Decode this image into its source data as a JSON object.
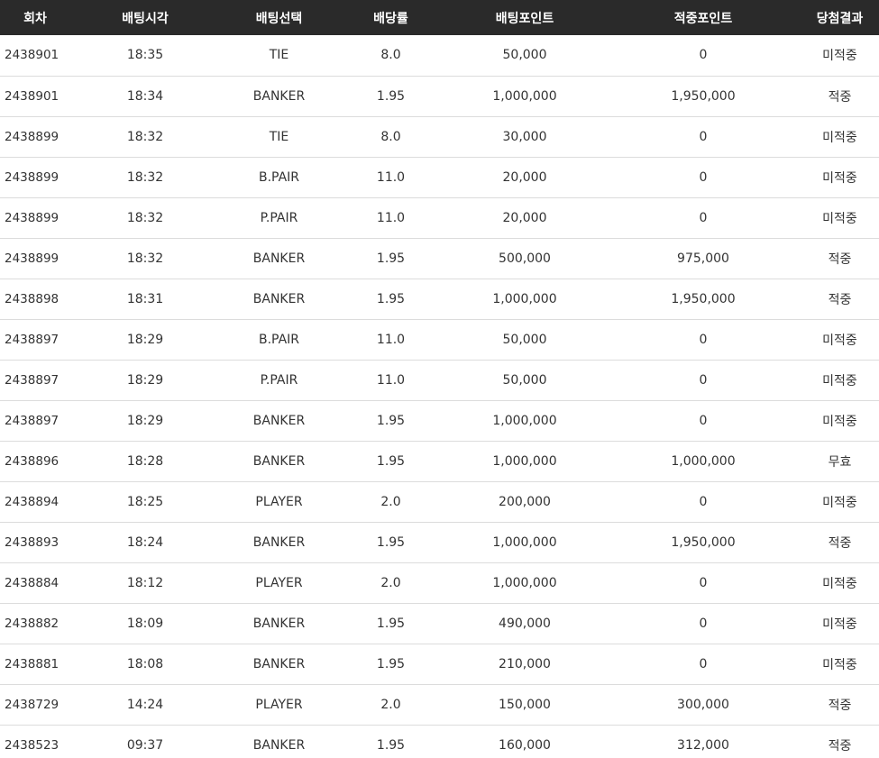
{
  "headers": {
    "round": "회차",
    "time": "배팅시각",
    "choice": "배팅선택",
    "odds": "배당률",
    "bet_points": "배팅포인트",
    "win_points": "적중포인트",
    "result": "당첨결과"
  },
  "rows": [
    {
      "round": "2438901",
      "time": "18:35",
      "choice": "TIE",
      "odds": "8.0",
      "bet_points": "50,000",
      "win_points": "0",
      "result": "미적중"
    },
    {
      "round": "2438901",
      "time": "18:34",
      "choice": "BANKER",
      "odds": "1.95",
      "bet_points": "1,000,000",
      "win_points": "1,950,000",
      "result": "적중"
    },
    {
      "round": "2438899",
      "time": "18:32",
      "choice": "TIE",
      "odds": "8.0",
      "bet_points": "30,000",
      "win_points": "0",
      "result": "미적중"
    },
    {
      "round": "2438899",
      "time": "18:32",
      "choice": "B.PAIR",
      "odds": "11.0",
      "bet_points": "20,000",
      "win_points": "0",
      "result": "미적중"
    },
    {
      "round": "2438899",
      "time": "18:32",
      "choice": "P.PAIR",
      "odds": "11.0",
      "bet_points": "20,000",
      "win_points": "0",
      "result": "미적중"
    },
    {
      "round": "2438899",
      "time": "18:32",
      "choice": "BANKER",
      "odds": "1.95",
      "bet_points": "500,000",
      "win_points": "975,000",
      "result": "적중"
    },
    {
      "round": "2438898",
      "time": "18:31",
      "choice": "BANKER",
      "odds": "1.95",
      "bet_points": "1,000,000",
      "win_points": "1,950,000",
      "result": "적중"
    },
    {
      "round": "2438897",
      "time": "18:29",
      "choice": "B.PAIR",
      "odds": "11.0",
      "bet_points": "50,000",
      "win_points": "0",
      "result": "미적중"
    },
    {
      "round": "2438897",
      "time": "18:29",
      "choice": "P.PAIR",
      "odds": "11.0",
      "bet_points": "50,000",
      "win_points": "0",
      "result": "미적중"
    },
    {
      "round": "2438897",
      "time": "18:29",
      "choice": "BANKER",
      "odds": "1.95",
      "bet_points": "1,000,000",
      "win_points": "0",
      "result": "미적중"
    },
    {
      "round": "2438896",
      "time": "18:28",
      "choice": "BANKER",
      "odds": "1.95",
      "bet_points": "1,000,000",
      "win_points": "1,000,000",
      "result": "무효"
    },
    {
      "round": "2438894",
      "time": "18:25",
      "choice": "PLAYER",
      "odds": "2.0",
      "bet_points": "200,000",
      "win_points": "0",
      "result": "미적중"
    },
    {
      "round": "2438893",
      "time": "18:24",
      "choice": "BANKER",
      "odds": "1.95",
      "bet_points": "1,000,000",
      "win_points": "1,950,000",
      "result": "적중"
    },
    {
      "round": "2438884",
      "time": "18:12",
      "choice": "PLAYER",
      "odds": "2.0",
      "bet_points": "1,000,000",
      "win_points": "0",
      "result": "미적중"
    },
    {
      "round": "2438882",
      "time": "18:09",
      "choice": "BANKER",
      "odds": "1.95",
      "bet_points": "490,000",
      "win_points": "0",
      "result": "미적중"
    },
    {
      "round": "2438881",
      "time": "18:08",
      "choice": "BANKER",
      "odds": "1.95",
      "bet_points": "210,000",
      "win_points": "0",
      "result": "미적중"
    },
    {
      "round": "2438729",
      "time": "14:24",
      "choice": "PLAYER",
      "odds": "2.0",
      "bet_points": "150,000",
      "win_points": "300,000",
      "result": "적중"
    },
    {
      "round": "2438523",
      "time": "09:37",
      "choice": "BANKER",
      "odds": "1.95",
      "bet_points": "160,000",
      "win_points": "312,000",
      "result": "적중"
    }
  ]
}
